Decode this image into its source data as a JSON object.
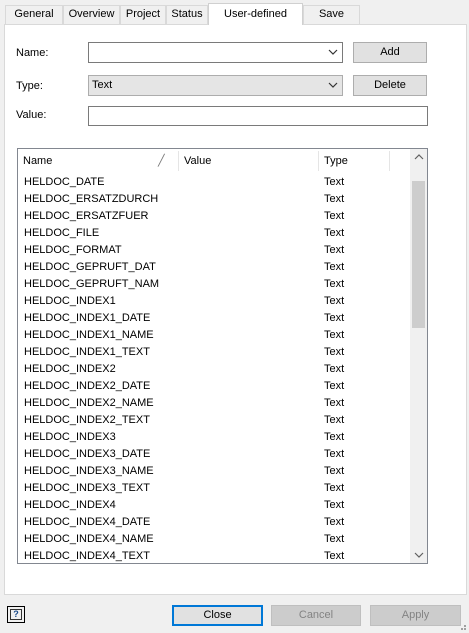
{
  "tabs": [
    "General",
    "Overview",
    "Project",
    "Status",
    "User-defined",
    "Save"
  ],
  "active_tab": "User-defined",
  "form": {
    "name_label": "Name:",
    "name_value": "",
    "type_label": "Type:",
    "type_value": "Text",
    "value_label": "Value:",
    "value_value": ""
  },
  "buttons": {
    "add": "Add",
    "delete": "Delete",
    "close": "Close",
    "cancel": "Cancel",
    "apply": "Apply"
  },
  "list": {
    "columns": [
      "Name",
      "Value",
      "Type"
    ],
    "rows": [
      {
        "name": "HELDOC_DATE",
        "value": "",
        "type": "Text"
      },
      {
        "name": "HELDOC_ERSATZDURCH",
        "value": "",
        "type": "Text"
      },
      {
        "name": "HELDOC_ERSATZFUER",
        "value": "",
        "type": "Text"
      },
      {
        "name": "HELDOC_FILE",
        "value": "",
        "type": "Text"
      },
      {
        "name": "HELDOC_FORMAT",
        "value": "",
        "type": "Text"
      },
      {
        "name": "HELDOC_GEPRUFT_DAT",
        "value": "",
        "type": "Text"
      },
      {
        "name": "HELDOC_GEPRUFT_NAM",
        "value": "",
        "type": "Text"
      },
      {
        "name": "HELDOC_INDEX1",
        "value": "",
        "type": "Text"
      },
      {
        "name": "HELDOC_INDEX1_DATE",
        "value": "",
        "type": "Text"
      },
      {
        "name": "HELDOC_INDEX1_NAME",
        "value": "",
        "type": "Text"
      },
      {
        "name": "HELDOC_INDEX1_TEXT",
        "value": "",
        "type": "Text"
      },
      {
        "name": "HELDOC_INDEX2",
        "value": "",
        "type": "Text"
      },
      {
        "name": "HELDOC_INDEX2_DATE",
        "value": "",
        "type": "Text"
      },
      {
        "name": "HELDOC_INDEX2_NAME",
        "value": "",
        "type": "Text"
      },
      {
        "name": "HELDOC_INDEX2_TEXT",
        "value": "",
        "type": "Text"
      },
      {
        "name": "HELDOC_INDEX3",
        "value": "",
        "type": "Text"
      },
      {
        "name": "HELDOC_INDEX3_DATE",
        "value": "",
        "type": "Text"
      },
      {
        "name": "HELDOC_INDEX3_NAME",
        "value": "",
        "type": "Text"
      },
      {
        "name": "HELDOC_INDEX3_TEXT",
        "value": "",
        "type": "Text"
      },
      {
        "name": "HELDOC_INDEX4",
        "value": "",
        "type": "Text"
      },
      {
        "name": "HELDOC_INDEX4_DATE",
        "value": "",
        "type": "Text"
      },
      {
        "name": "HELDOC_INDEX4_NAME",
        "value": "",
        "type": "Text"
      },
      {
        "name": "HELDOC_INDEX4_TEXT",
        "value": "",
        "type": "Text"
      }
    ]
  },
  "icons": {
    "combo_arrow": "chevron-down-icon",
    "scroll_up": "scroll-up-arrow-icon",
    "scroll_down": "scroll-down-arrow-icon",
    "help": "context-help-icon"
  },
  "colors": {
    "default_button_border": "#0078d7",
    "disabled_text": "#838383"
  }
}
